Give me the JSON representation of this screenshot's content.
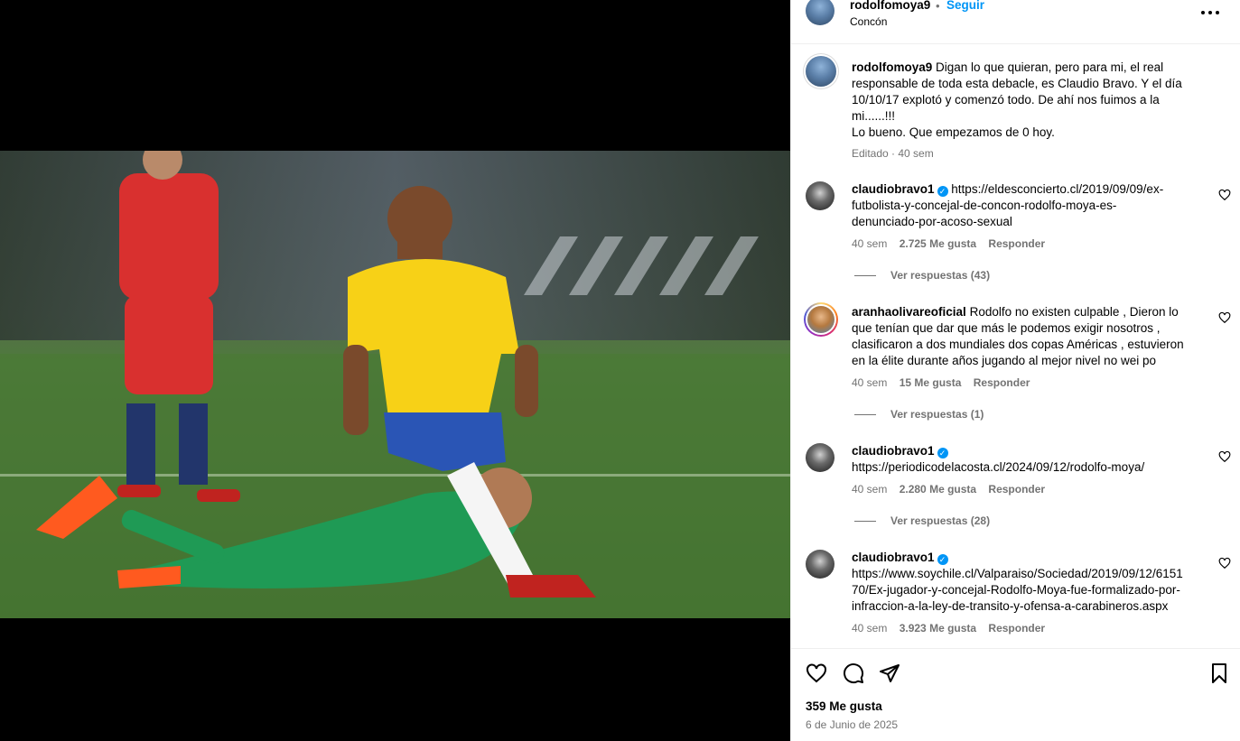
{
  "post": {
    "username": "rodolfomoya9",
    "separator": "•",
    "follow_label": "Seguir",
    "location": "Concón",
    "caption_lines": [
      "Digan lo que quieran, pero para mi, el real",
      "responsable de toda esta debacle, es Claudio Bravo. Y el día",
      "10/10/17 explotó y comenzó todo. De ahí nos fuimos a la",
      "mi......!!!",
      "Lo bueno. Que empezamos de 0 hoy."
    ],
    "caption_meta": "Editado · 40 sem"
  },
  "comments": [
    {
      "username": "claudiobravo1",
      "verified": true,
      "lines": [
        "https://eldesconcierto.cl/2019/09/09/ex-",
        "futbolista-y-concejal-de-concon-rodolfo-moya-es-",
        "denunciado-por-acoso-sexual"
      ],
      "time": "40 sem",
      "likes": "2.725 Me gusta",
      "reply": "Responder",
      "view_replies": "Ver respuestas (43)"
    },
    {
      "username": "aranhaolivareoficial",
      "verified": false,
      "lines": [
        "Rodolfo no existen culpable , Dieron lo",
        "que tenían que dar que más le podemos exigir nosotros ,",
        "clasificaron a dos mundiales dos copas Américas , estuvieron",
        "en la élite durante años jugando al mejor nivel no wei po"
      ],
      "time": "40 sem",
      "likes": "15 Me gusta",
      "reply": "Responder",
      "view_replies": "Ver respuestas (1)"
    },
    {
      "username": "claudiobravo1",
      "verified": true,
      "lines": [
        "https://periodicodelacosta.cl/2024/09/12/rodolfo-moya/"
      ],
      "time": "40 sem",
      "likes": "2.280 Me gusta",
      "reply": "Responder",
      "view_replies": "Ver respuestas (28)"
    },
    {
      "username": "claudiobravo1",
      "verified": true,
      "lines": [
        "https://www.soychile.cl/Valparaiso/Sociedad/2019/09/12/6151",
        "70/Ex-jugador-y-concejal-Rodolfo-Moya-fue-formalizado-por-",
        "infraccion-a-la-ley-de-transito-y-ofensa-a-carabineros.aspx"
      ],
      "time": "40 sem",
      "likes": "3.923 Me gusta",
      "reply": "Responder"
    }
  ],
  "footer": {
    "likes": "359 Me gusta",
    "date": "6 de Junio de 2025"
  },
  "icons": {
    "more": "more-options-icon",
    "like": "heart-icon",
    "comment": "comment-icon",
    "share": "share-icon",
    "save": "bookmark-icon",
    "verified": "verified-badge-icon"
  },
  "colors": {
    "link_blue": "#0095f6",
    "muted": "#737373",
    "divider": "#efefef"
  }
}
